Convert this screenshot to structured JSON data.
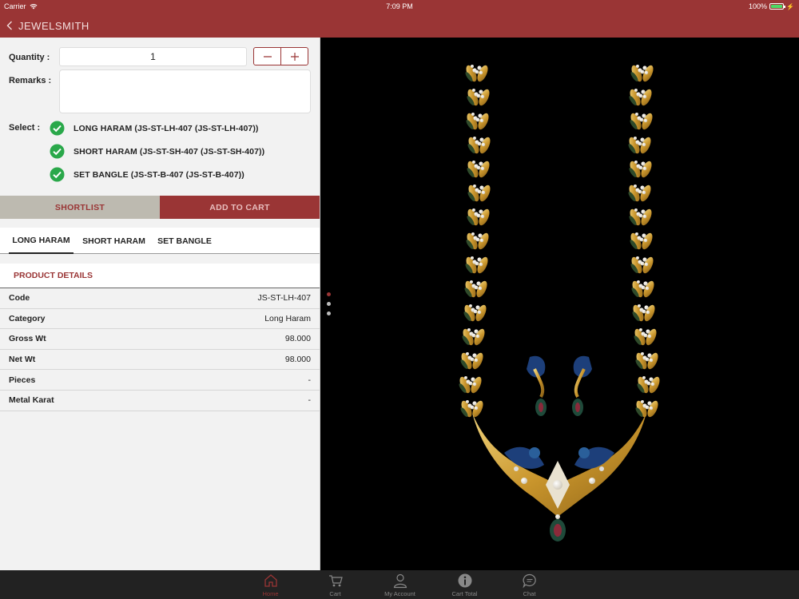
{
  "status": {
    "carrier": "Carrier",
    "time": "7:09 PM",
    "battery": "100%"
  },
  "nav": {
    "title": "JEWELSMITH"
  },
  "form": {
    "quantity_label": "Quantity :",
    "quantity_value": "1",
    "remarks_label": "Remarks :",
    "remarks_value": "",
    "select_label": "Select :",
    "options": [
      {
        "label": "LONG HARAM (JS-ST-LH-407 (JS-ST-LH-407))",
        "checked": true
      },
      {
        "label": "SHORT HARAM (JS-ST-SH-407 (JS-ST-SH-407))",
        "checked": true
      },
      {
        "label": "SET BANGLE (JS-ST-B-407 (JS-ST-B-407))",
        "checked": true
      }
    ]
  },
  "actions": {
    "shortlist": "SHORTLIST",
    "add_to_cart": "ADD TO CART"
  },
  "tabs": [
    "LONG HARAM",
    "SHORT HARAM",
    "SET BANGLE"
  ],
  "active_tab": 0,
  "details": {
    "title": "PRODUCT DETAILS",
    "rows": [
      {
        "key": "Code",
        "value": "JS-ST-LH-407"
      },
      {
        "key": "Category",
        "value": "Long Haram"
      },
      {
        "key": "Gross Wt",
        "value": "98.000"
      },
      {
        "key": "Net Wt",
        "value": "98.000"
      },
      {
        "key": "Pieces",
        "value": "-"
      },
      {
        "key": "Metal Karat",
        "value": "-"
      }
    ]
  },
  "gallery": {
    "page_count": 3,
    "current_page": 1
  },
  "tabbar": [
    {
      "label": "Home",
      "icon": "home-icon",
      "active": true
    },
    {
      "label": "Cart",
      "icon": "cart-icon",
      "active": false
    },
    {
      "label": "My Account",
      "icon": "user-icon",
      "active": false
    },
    {
      "label": "Cart Total",
      "icon": "info-icon",
      "active": false
    },
    {
      "label": "Chat",
      "icon": "chat-icon",
      "active": false
    }
  ],
  "colors": {
    "brand": "#9a3535",
    "check_green": "#2aa84a",
    "gold": "#d4a437",
    "tabbar_bg": "#222222"
  }
}
